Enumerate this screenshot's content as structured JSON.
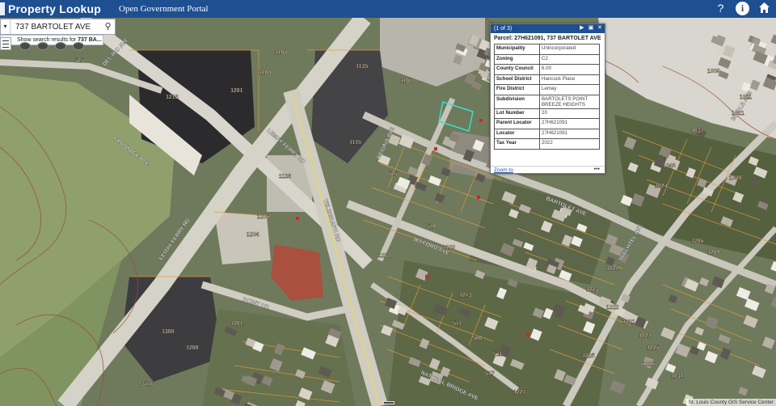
{
  "header": {
    "title": "Property Lookup",
    "portal_link": "Open Government Portal",
    "icons": [
      "help-icon",
      "info-icon",
      "home-icon"
    ]
  },
  "search": {
    "value": "737 BARTOLET AVE",
    "suggestion_prefix": "Show search results for ",
    "suggestion_term": "737 BA..."
  },
  "map": {
    "street_labels": [
      "BARTOLET AVE",
      "LEMAY FERRY RD",
      "TELEGRAPH RD",
      "POINT DR",
      "REGINA AVE",
      "JEFFORD AVE",
      "WACHTEL AVE",
      "NATURAL BRIDGE AVE",
      "FRONTAGE AVE",
      "BIDDLE AVE",
      "DEL RIO AVE"
    ],
    "parcel_labels": [
      "1213",
      "1201",
      "1108",
      "1109",
      "1135",
      "1107",
      "1115",
      "1126",
      "1206",
      "1204",
      "1202",
      "1300",
      "1200",
      "1201",
      "525",
      "1009",
      "1011",
      "1037",
      "1040",
      "1021",
      "1043",
      "1024",
      "1206",
      "1209",
      "1221",
      "1223",
      "1222",
      "1221",
      "1224",
      "1225",
      "1226",
      "1231",
      "1225",
      "1227",
      "1120",
      "1213",
      "511",
      "500",
      "511",
      "517",
      "510",
      "525",
      "3716",
      "1300"
    ]
  },
  "popup": {
    "count": "(1 of 3)",
    "title": "Parcel: 27H621091, 737 BARTOLET AVE",
    "rows": [
      {
        "key": "Municipality",
        "value": "Unincorporated"
      },
      {
        "key": "Zoning",
        "value": "C2"
      },
      {
        "key": "County Council",
        "value": "6.00"
      },
      {
        "key": "School District",
        "value": "Hancock Place"
      },
      {
        "key": "Fire District",
        "value": "Lemay"
      },
      {
        "key": "Subdivision",
        "value": "BARTOLETS POINT BREEZE HEIGHTS"
      },
      {
        "key": "Lot Number",
        "value": "20"
      },
      {
        "key": "Parent Locator",
        "value": "27H621091"
      },
      {
        "key": "Locator",
        "value": "27H621091"
      },
      {
        "key": "Tax Year",
        "value": "2022"
      }
    ],
    "zoom_label": "Zoom to",
    "more_label": "•••"
  },
  "credit": "St. Louis County GIS Service Center"
}
